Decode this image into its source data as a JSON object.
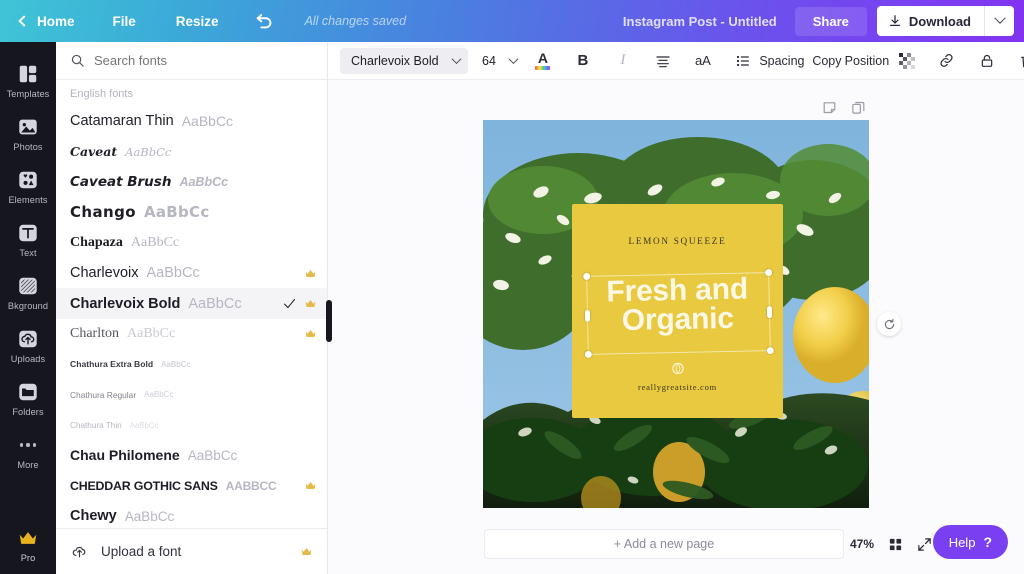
{
  "topbar": {
    "home": "Home",
    "file": "File",
    "resize": "Resize",
    "undo_icon": "undo-arrow-icon",
    "saved_status": "All changes saved",
    "doc_title": "Instagram Post - Untitled",
    "share": "Share",
    "download": "Download",
    "download_icon": "download-arrow-icon",
    "gradient_start": "#3fc5d6",
    "gradient_end": "#8133f0"
  },
  "rail": {
    "items": [
      {
        "label": "Templates",
        "icon": "templates-icon"
      },
      {
        "label": "Photos",
        "icon": "photo-icon"
      },
      {
        "label": "Elements",
        "icon": "elements-icon"
      },
      {
        "label": "Text",
        "icon": "text-icon"
      },
      {
        "label": "Bkground",
        "icon": "background-icon"
      },
      {
        "label": "Uploads",
        "icon": "upload-cloud-icon"
      },
      {
        "label": "Folders",
        "icon": "folder-icon"
      },
      {
        "label": "More",
        "icon": "ellipsis-icon"
      }
    ],
    "pro": {
      "label": "Pro",
      "icon": "crown-icon",
      "color": "#e8b11e"
    }
  },
  "panel": {
    "search_placeholder": "Search fonts",
    "search_icon": "search-icon",
    "group_label": "English fonts",
    "sample_text": "AaBbCc",
    "fonts": [
      {
        "name": "Catamaran Thin",
        "sample": "AaBbCc",
        "pro": false,
        "selected": false
      },
      {
        "name": "Caveat",
        "sample": "AaBbCc",
        "pro": false,
        "selected": false
      },
      {
        "name": "Caveat Brush",
        "sample": "AaBbCc",
        "pro": false,
        "selected": false
      },
      {
        "name": "Chango",
        "sample": "AaBbCc",
        "pro": false,
        "selected": false
      },
      {
        "name": "Chapaza",
        "sample": "AaBbCc",
        "pro": false,
        "selected": false
      },
      {
        "name": "Charlevoix",
        "sample": "AaBbCc",
        "pro": true,
        "selected": false
      },
      {
        "name": "Charlevoix Bold",
        "sample": "AaBbCc",
        "pro": true,
        "selected": true
      },
      {
        "name": "Charlton",
        "sample": "AaBbCc",
        "pro": true,
        "selected": false
      },
      {
        "name": "Chathura Extra Bold",
        "sample": "AaBbCc",
        "pro": false,
        "selected": false
      },
      {
        "name": "Chathura Regular",
        "sample": "AaBbCc",
        "pro": false,
        "selected": false
      },
      {
        "name": "Chathura Thin",
        "sample": "AaBbCc",
        "pro": false,
        "selected": false
      },
      {
        "name": "Chau Philomene",
        "sample": "AaBbCc",
        "pro": false,
        "selected": false
      },
      {
        "name": "CHEDDAR GOTHIC SANS",
        "sample": "AABBCC",
        "pro": true,
        "selected": false
      },
      {
        "name": "Chewy",
        "sample": "AaBbCc",
        "pro": false,
        "selected": false
      }
    ],
    "upload_font": "Upload a font",
    "upload_icon": "upload-cloud-icon",
    "upload_pro": true
  },
  "toolbar": {
    "font_family": "Charlevoix Bold",
    "font_size": "64",
    "color_icon": "text-color-icon",
    "bold": "B",
    "italic": "I",
    "align_icon": "align-center-icon",
    "case": "aA",
    "list_icon": "bullet-list-icon",
    "spacing": "Spacing",
    "copy": "Copy",
    "position": "Position",
    "transparency_icon": "transparency-icon",
    "link_icon": "link-icon",
    "lock_icon": "lock-icon",
    "delete_icon": "trash-icon"
  },
  "canvas": {
    "page_tools": [
      {
        "icon": "notes-icon"
      },
      {
        "icon": "duplicate-page-icon"
      }
    ],
    "card": {
      "kicker": "LEMON SQUEEZE",
      "headline_line1": "Fresh and",
      "headline_line2": "Organic",
      "url": "reallygreatsite.com",
      "logo_icon": "lemon-logo-icon",
      "bg_color": "#e8c93f",
      "headline_color": "#fdf8e6"
    },
    "rotate_icon": "rotate-icon",
    "selection": "text-selection-box"
  },
  "bottombar": {
    "add_page": "+ Add a new page",
    "zoom": "47%",
    "grid_icon": "grid-view-icon",
    "expand_icon": "fullscreen-icon",
    "help": "Help",
    "help_q": "?",
    "help_color": "#7b3ff2"
  }
}
